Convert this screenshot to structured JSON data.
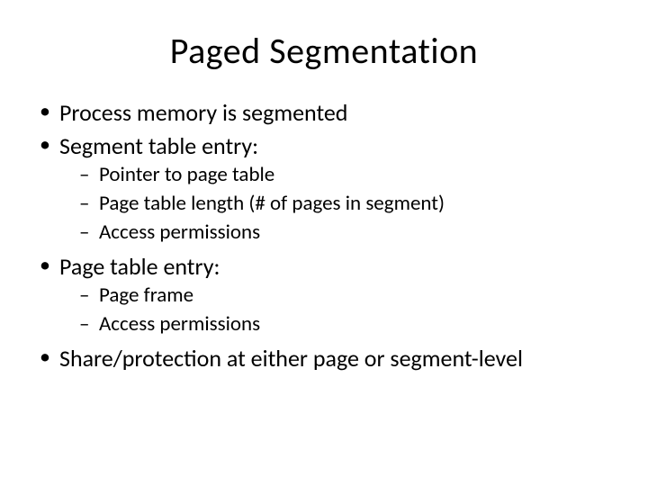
{
  "title": "Paged Segmentation",
  "bullets": [
    {
      "text": "Process memory is segmented",
      "sub": []
    },
    {
      "text": "Segment table entry:",
      "sub": [
        "Pointer to page table",
        "Page table length (# of pages in segment)",
        "Access permissions"
      ]
    },
    {
      "text": "Page table entry:",
      "sub": [
        "Page frame",
        "Access permissions"
      ]
    },
    {
      "text": "Share/protection at either page or segment-level",
      "sub": []
    }
  ]
}
